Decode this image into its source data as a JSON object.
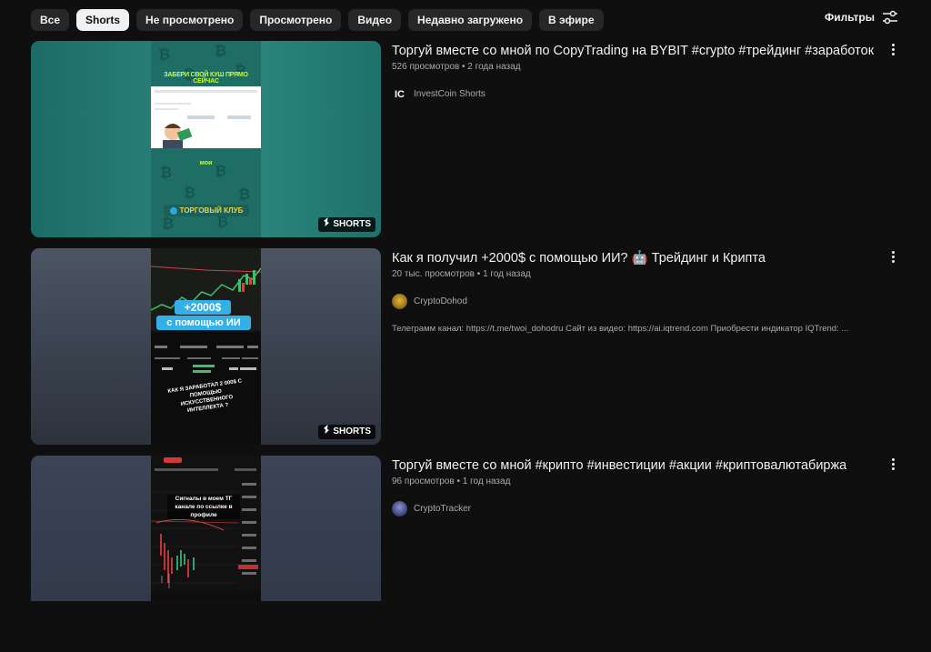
{
  "chips": [
    "Все",
    "Shorts",
    "Не просмотрено",
    "Просмотрено",
    "Видео",
    "Недавно загружено",
    "В эфире"
  ],
  "active_chip": "Shorts",
  "filters_label": "Фильтры",
  "shorts_badge": "SHORTS",
  "videos": [
    {
      "title": "Торгуй вместе со мной по CopyTrading на BYBIT #crypto #трейдинг #заработок",
      "views": "526 просмотров",
      "age": "2 года назад",
      "channel": "InvestCoin Shorts",
      "avatar_text": "IC",
      "description": "",
      "thumb": {
        "top_caption": "ЗАБЕРИ СВОЙ КУШ ПРЯМО СЕЙЧАС",
        "mid_caption": "мои",
        "bottom_caption": "ТОРГОВЫЙ КЛУБ"
      }
    },
    {
      "title": "Как я получил +2000$ с помощью ИИ? 🤖 Трейдинг и Крипта",
      "views": "20 тыс. просмотров",
      "age": "1 год назад",
      "channel": "CryptoDohod",
      "avatar_text": "",
      "description": "Телеграмм канал: https://t.me/twoi_dohodru Сайт из видео: https://ai.iqtrend.com Приобрести индикатор IQTrend: ...",
      "thumb": {
        "line1": "+2000$",
        "line2": "с помощью ИИ",
        "caption": "КАК Я ЗАРАБОТАЛ 2 000$ С ПОМОЩЬЮ ИСКУССТВЕННОГО ИНТЕЛЛЕКТА ?"
      }
    },
    {
      "title": "Торгуй вместе со мной #крипто #инвестиции #акции #криптовалютабиржа",
      "views": "96 просмотров",
      "age": "1 год назад",
      "channel": "CryptoTracker",
      "avatar_text": "",
      "description": "",
      "thumb": {
        "caption": "Сигналы в моем ТГ канале по ссылке в профиле"
      }
    }
  ],
  "colors": {
    "background": "#0f0f0f",
    "chip_bg": "#272727",
    "chip_active_bg": "#f1f1f1",
    "text_secondary": "#aaaaaa"
  },
  "icons": {
    "filters": "sliders-icon",
    "more": "vertical-dots-icon",
    "shorts": "shorts-logo-icon"
  }
}
